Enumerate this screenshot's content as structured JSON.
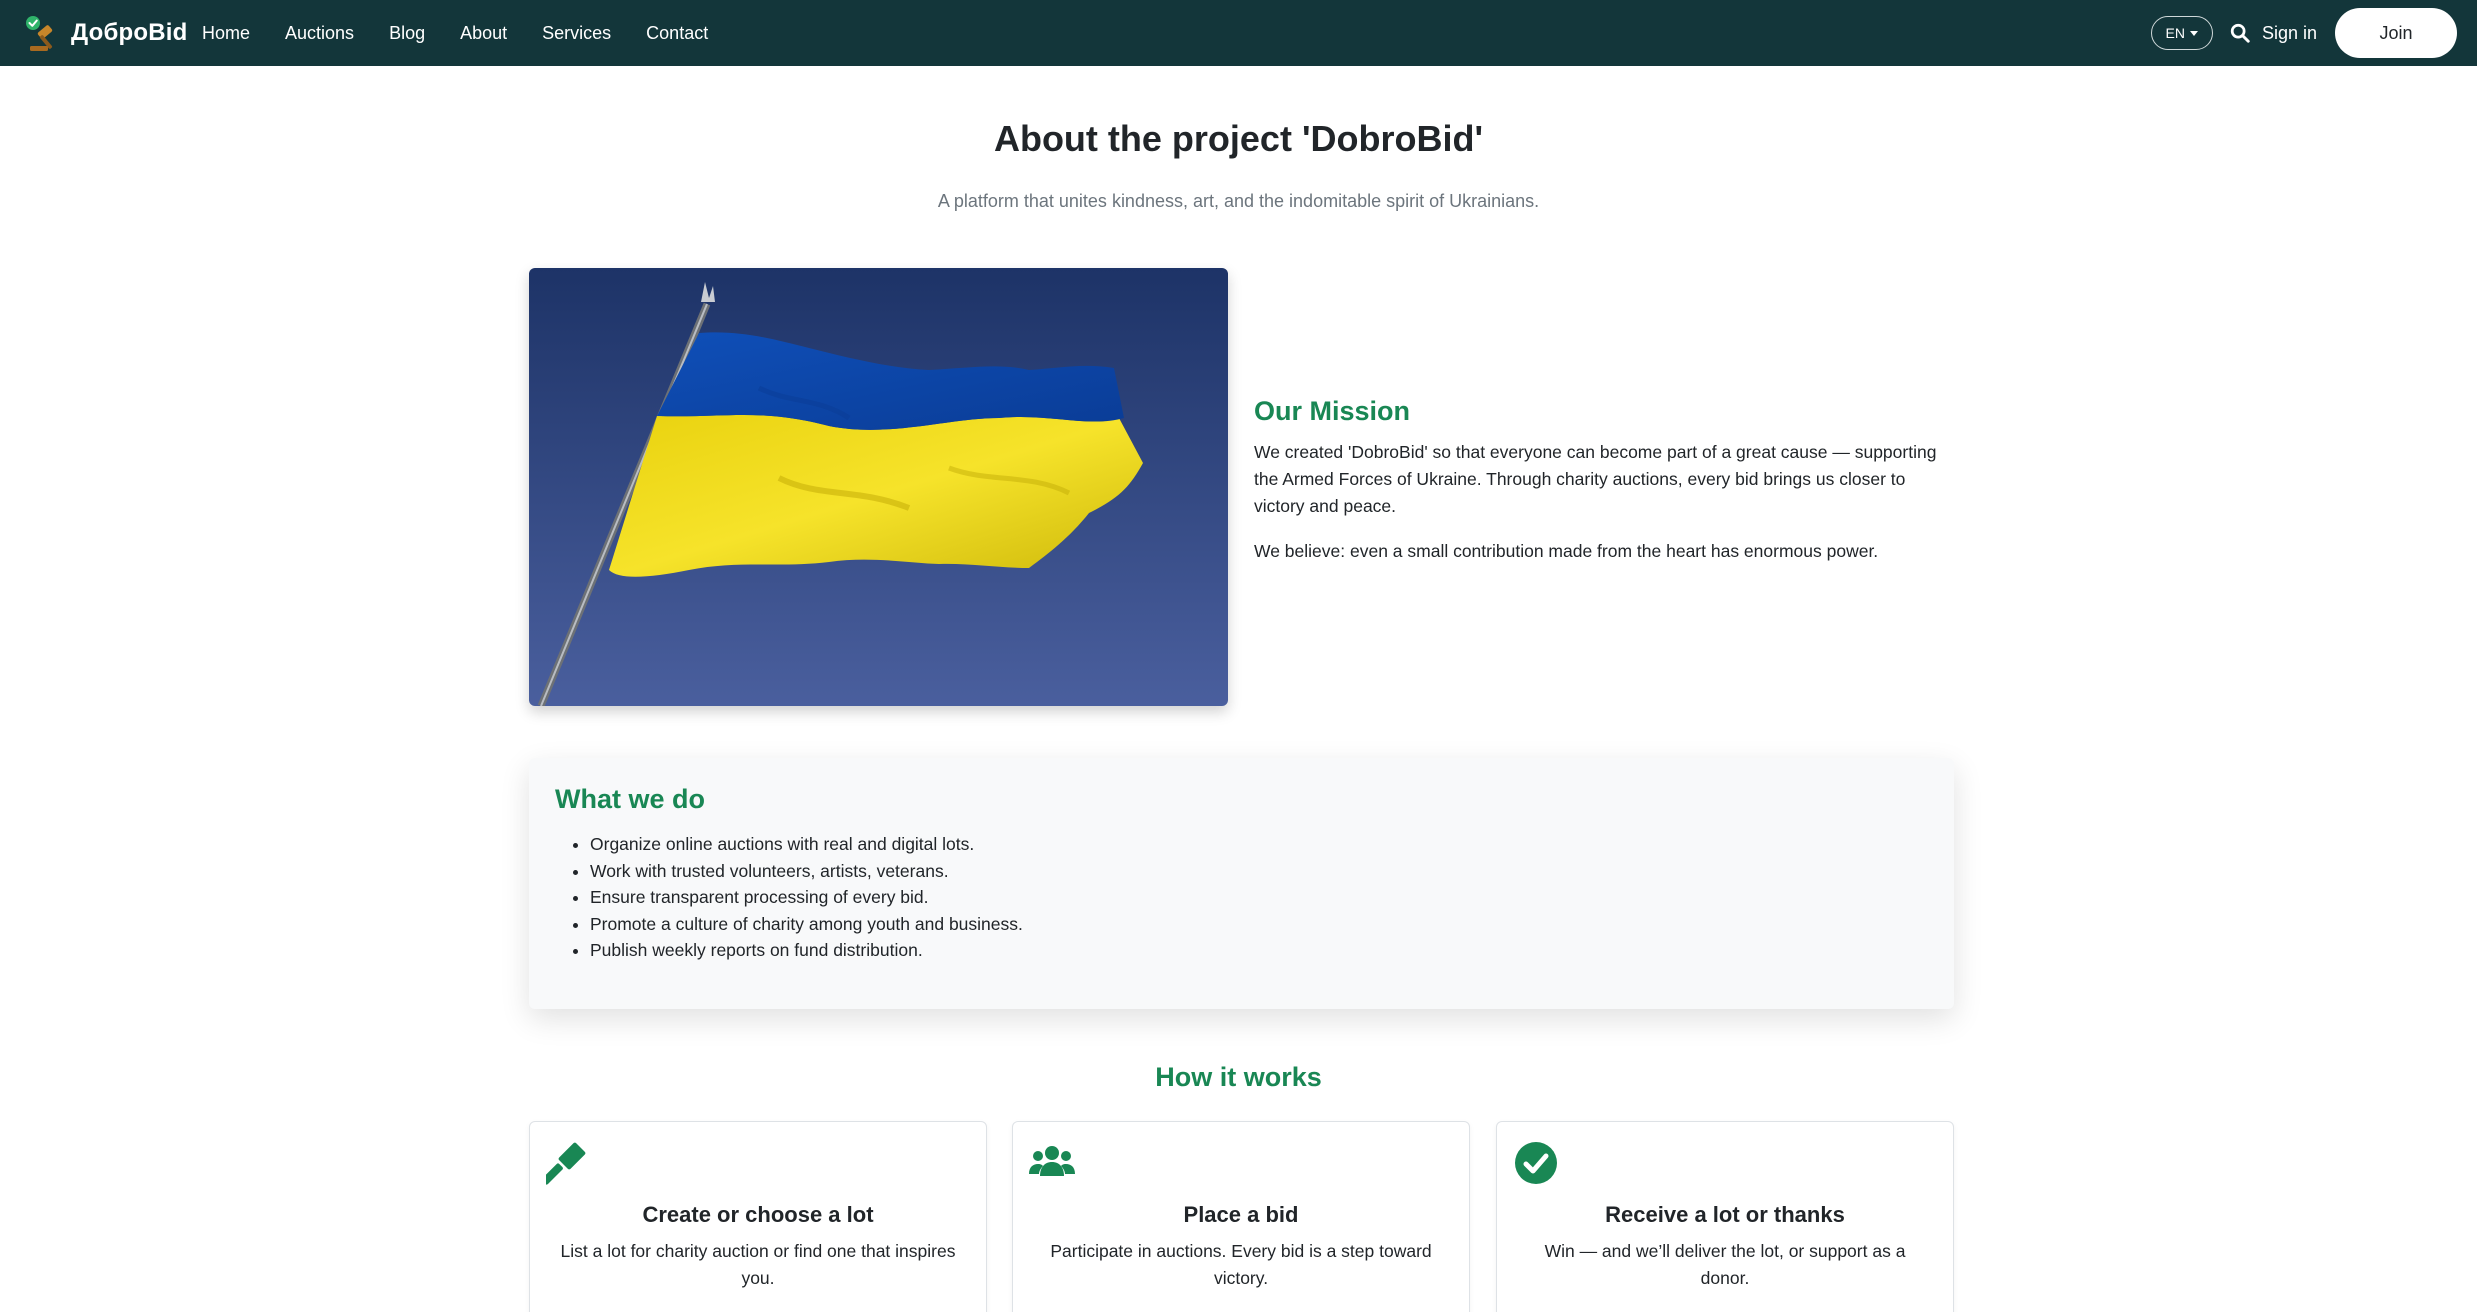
{
  "navbar": {
    "brand": "ДоброBid",
    "links": [
      "Home",
      "Auctions",
      "Blog",
      "About",
      "Services",
      "Contact"
    ],
    "lang": "EN",
    "signin": "Sign in",
    "join": "Join"
  },
  "header": {
    "title": "About the project 'DobroBid'",
    "subtitle": "A platform that unites kindness, art, and the indomitable spirit of Ukrainians."
  },
  "mission": {
    "title": "Our Mission",
    "paragraphs": [
      "We created 'DobroBid' so that everyone can become part of a great cause — supporting the Armed Forces of Ukraine. Through charity auctions, every bid brings us closer to victory and peace.",
      "We believe: even a small contribution made from the heart has enormous power."
    ]
  },
  "whatwedo": {
    "title": "What we do",
    "items": [
      "Organize online auctions with real and digital lots.",
      "Work with trusted volunteers, artists, veterans.",
      "Ensure transparent processing of every bid.",
      "Promote a culture of charity among youth and business.",
      "Publish weekly reports on fund distribution."
    ]
  },
  "how": {
    "title": "How it works",
    "steps": [
      {
        "icon": "gavel-icon",
        "title": "Create or choose a lot",
        "desc": "List a lot for charity auction or find one that inspires you."
      },
      {
        "icon": "users-icon",
        "title": "Place a bid",
        "desc": "Participate in auctions. Every bid is a step toward victory."
      },
      {
        "icon": "check-circle-icon",
        "title": "Receive a lot or thanks",
        "desc": "Win — and we’ll deliver the lot, or support as a donor."
      }
    ]
  },
  "colors": {
    "navbar_bg": "#13363a",
    "accent_green": "#198754",
    "flag_blue": "#0057b7",
    "flag_yellow": "#ffd700"
  }
}
